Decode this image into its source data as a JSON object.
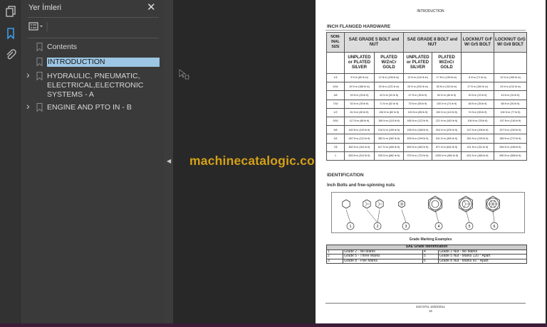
{
  "sidebar": {
    "title": "Yer İmleri",
    "close": "✕",
    "bookmarks": [
      {
        "label": "Contents",
        "expandable": false,
        "selected": false
      },
      {
        "label": "INTRODUCTION",
        "expandable": false,
        "selected": true
      },
      {
        "label": "HYDRAULIC, PNEUMATIC, ELECTRICAL,ELECTRONIC SYSTEMS - A",
        "expandable": true,
        "selected": false
      },
      {
        "label": "ENGINE AND PTO IN - B",
        "expandable": true,
        "selected": false
      }
    ]
  },
  "watermark": "machinecatalogic.com",
  "colors": {
    "accent": "#3d9be9",
    "selection": "#9cc6e4",
    "watermark": "#d4a017"
  },
  "page": {
    "header": "INTRODUCTION",
    "section_title": "INCH FLANGED HARDWARE",
    "table": {
      "head1": [
        "NOM-INAL SIZE",
        "SAE GRADE 5 BOLT and NUT",
        "SAE GRADE 8 BOLT and NUT",
        "LOCKNUT GrF W/ Gr5 BOLT",
        "LOCKNUT GrG W/ Gr8 BOLT"
      ],
      "head2": [
        "",
        "UNPLATED or PLATED SILVER",
        "PLATED W/ZnCr GOLD",
        "UNPLATED or PLATED SILVER",
        "PLATED W/ZnCr GOLD",
        "",
        ""
      ],
      "rows": [
        [
          "1/4",
          "9 N·m (80 lb in)",
          "12 N·m (106 lb in)",
          "13 N·m (115 lb in)",
          "17 N·m (150 lb in)",
          "8 N·m (71 lb in)",
          "12 N·m (106 lb in)"
        ],
        [
          "5/16",
          "19 N·m (168 lb in)",
          "25 N·m (221 lb in)",
          "26 N·m (230 lb in)",
          "35 N·m (310 lb in)",
          "17 N·m (150 lb in)",
          "24 N·m (212 lb in)"
        ],
        [
          "3/8",
          "33 N·m (25 lb ft)",
          "44 N·m (33 lb ft)",
          "47 N·m (35 lb ft)",
          "63 N·m (46 lb ft)",
          "30 N·m (22 lb ft)",
          "43 N·m (32 lb ft)"
        ],
        [
          "7/16",
          "53 N·m (39 lb ft)",
          "71 N·m (52 lb ft)",
          "75 N·m (55 lb ft)",
          "100 N·m (74 lb ft)",
          "48 N·m (35 lb ft)",
          "68 N·m (50 lb ft)"
        ],
        [
          "1/2",
          "81 N·m (60 lb ft)",
          "108 N·m (80 lb ft)",
          "115 N·m (85 lb ft)",
          "153 N·m (113 lb ft)",
          "74 N·m (55 lb ft)",
          "104 N·m (77 lb ft)"
        ],
        [
          "9/16",
          "117 N·m (86 lb ft)",
          "156 N·m (115 lb ft)",
          "165 N·m (122 lb ft)",
          "221 N·m (163 lb ft)",
          "106 N·m (78 lb ft)",
          "157 N·m (116 lb ft)"
        ],
        [
          "5/8",
          "162 N·m (119 lb ft)",
          "216 N·m (159 lb ft)",
          "228 N·m (168 lb ft)",
          "304 N·m (225 lb ft)",
          "147 N·m (108 lb ft)",
          "207 N·m (153 lb ft)"
        ],
        [
          "3/4",
          "287 N·m (212 lb ft)",
          "383 N·m (282 lb ft)",
          "405 N·m (299 lb ft)",
          "541 N·m (399 lb ft)",
          "261 N·m (193 lb ft)",
          "369 N·m (272 lb ft)"
        ],
        [
          "7/8",
          "462 N·m (341 lb ft)",
          "617 N·m (455 lb ft)",
          "653 N·m (482 lb ft)",
          "871 N·m (642 lb ft)",
          "421 N·m (311 lb ft)",
          "594 N·m (438 lb ft)"
        ],
        [
          "1",
          "693 N·m (512 lb ft)",
          "925 N·m (682 lb ft)",
          "979 N·m (722 lb ft)",
          "1305 N·m (963 lb ft)",
          "631 N·m (465 lb ft)",
          "890 N·m (656 lb ft)"
        ]
      ]
    },
    "identification": "IDENTIFICATION",
    "subtitle": "Inch Bolts and free-spinning nuts",
    "figure_labels": [
      "1",
      "2",
      "3",
      "4",
      "5",
      "6"
    ],
    "figure_caption": "Grade Marking Examples",
    "grade_table": {
      "title": "SAE Grade Identification",
      "rows": [
        [
          "1",
          "Grade 2 - No Marks",
          "4",
          "Grade 2 Nut - No Marks"
        ],
        [
          "2",
          "Grade 5 - Three Marks",
          "5",
          "Grade 5 Nut - Marks 120 ° Apart"
        ],
        [
          "3",
          "Grade 8 - Five Marks",
          "6",
          "Grade 8 Nut - Marks 60 ° Apart"
        ]
      ]
    },
    "footer_code": "84473741 16/03/2011",
    "page_number": "16"
  }
}
